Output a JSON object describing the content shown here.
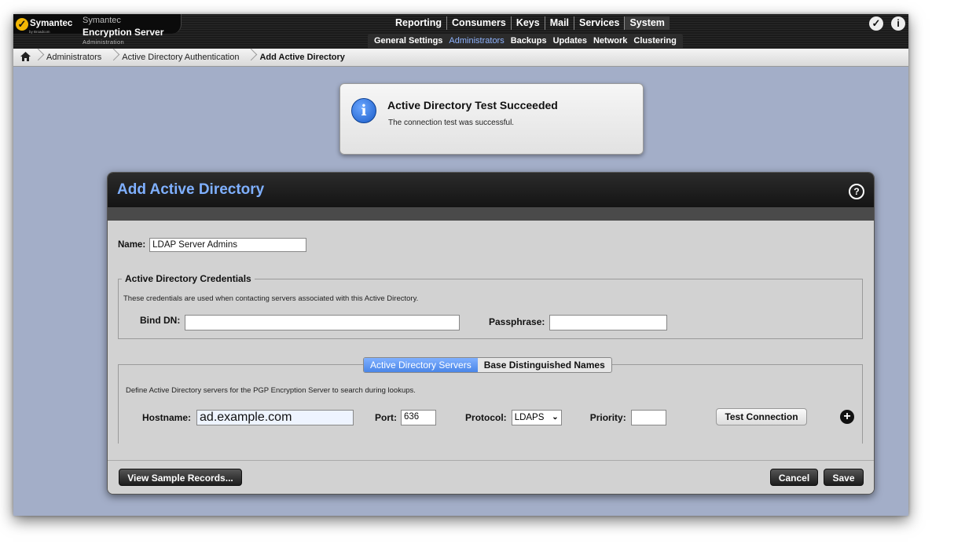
{
  "brand": {
    "logo_text": "Symantec",
    "logo_sub": "by Broadcom",
    "product_line1": "Symantec",
    "product_line2": "Encryption Server",
    "product_line3": "Administration"
  },
  "main_nav": [
    "Reporting",
    "Consumers",
    "Keys",
    "Mail",
    "Services",
    "System"
  ],
  "main_nav_active": "System",
  "sub_nav": [
    "General Settings",
    "Administrators",
    "Backups",
    "Updates",
    "Network",
    "Clustering"
  ],
  "sub_nav_active": "Administrators",
  "top_icons": {
    "check": "✓",
    "info": "i"
  },
  "breadcrumb": [
    "Administrators",
    "Active Directory Authentication",
    "Add Active Directory"
  ],
  "notification": {
    "icon": "info-icon",
    "title": "Active Directory Test Succeeded",
    "message": "The connection test was successful."
  },
  "dialog": {
    "title": "Add Active Directory",
    "help_glyph": "?",
    "name_label": "Name:",
    "name_value": "LDAP Server Admins",
    "credentials": {
      "legend": "Active Directory Credentials",
      "description": "These credentials are used when contacting servers associated with this Active Directory.",
      "bind_dn_label": "Bind DN:",
      "bind_dn_value": "",
      "passphrase_label": "Passphrase:",
      "passphrase_value": ""
    },
    "tabs": [
      "Active Directory Servers",
      "Base Distinguished Names"
    ],
    "active_tab": "Active Directory Servers",
    "servers": {
      "description": "Define Active Directory servers for the PGP Encryption Server to search during lookups.",
      "hostname_label": "Hostname:",
      "hostname_value": "ad.example.com",
      "port_label": "Port:",
      "port_value": "636",
      "protocol_label": "Protocol:",
      "protocol_value": "LDAPS",
      "priority_label": "Priority:",
      "priority_value": "",
      "test_button": "Test Connection",
      "add_glyph": "+"
    },
    "footer": {
      "view_sample": "View Sample Records...",
      "cancel": "Cancel",
      "save": "Save"
    }
  },
  "colors": {
    "background": "#a3aec8",
    "title_blue": "#7fb0ff",
    "tab_active": "#4a86e8"
  }
}
